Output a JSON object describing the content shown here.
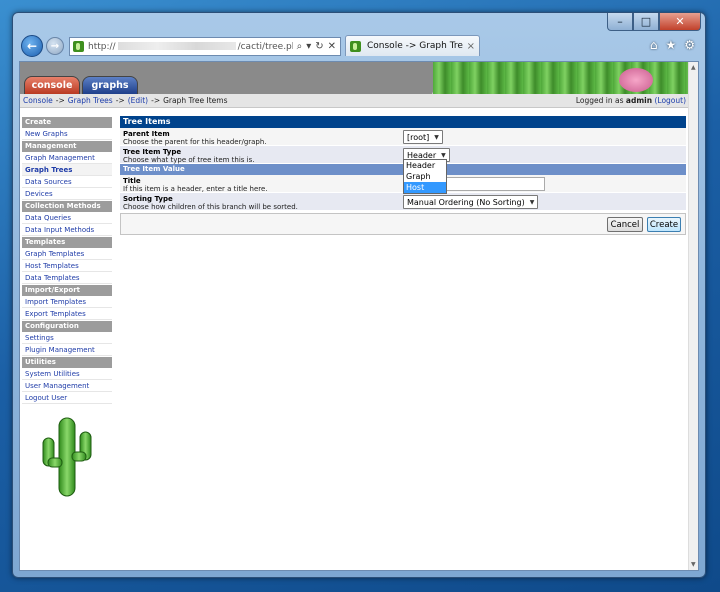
{
  "browser": {
    "url_prefix": "http://",
    "url_suffix": "/cacti/tree.php?actior",
    "tab_title": "Console -> Graph Trees ...",
    "tab_close": "×",
    "back_glyph": "←",
    "forward_glyph": "→",
    "addr_icons": [
      "search-icon",
      "dropdown-icon",
      "refresh-icon",
      "stop-icon"
    ],
    "toolbar_icons": [
      "home-icon",
      "favorites-star-icon",
      "settings-gear-icon"
    ]
  },
  "window": {
    "min": "–",
    "max": "□",
    "close": "✕"
  },
  "header": {
    "console_tab": "console",
    "graphs_tab": "graphs"
  },
  "breadcrumb": {
    "items": [
      "Console",
      "Graph Trees",
      "(Edit)"
    ],
    "separator": "->",
    "current": "Graph Tree Items",
    "login_prefix": "Logged in as",
    "user": "admin",
    "logout": "(Logout)"
  },
  "menu": {
    "create_head": "Create",
    "new_graphs": "New Graphs",
    "management_head": "Management",
    "graph_management": "Graph Management",
    "graph_trees": "Graph Trees",
    "data_sources": "Data Sources",
    "devices": "Devices",
    "collection_head": "Collection Methods",
    "data_queries": "Data Queries",
    "data_input_methods": "Data Input Methods",
    "templates_head": "Templates",
    "graph_templates": "Graph Templates",
    "host_templates": "Host Templates",
    "data_templates": "Data Templates",
    "import_export_head": "Import/Export",
    "import_templates": "Import Templates",
    "export_templates": "Export Templates",
    "configuration_head": "Configuration",
    "settings": "Settings",
    "plugin_management": "Plugin Management",
    "utilities_head": "Utilities",
    "system_utilities": "System Utilities",
    "user_management": "User Management",
    "logout_user": "Logout User"
  },
  "form": {
    "section_title": "Tree Items",
    "parent_label": "Parent Item",
    "parent_desc": "Choose the parent for this header/graph.",
    "parent_value": "[root]",
    "type_label": "Tree Item Type",
    "type_desc": "Choose what type of tree item this is.",
    "type_value": "Header",
    "type_options": [
      "Header",
      "Graph",
      "Host"
    ],
    "type_highlighted": "Host",
    "value_section": "Tree Item Value",
    "title_label": "Title",
    "title_desc": "If this item is a header, enter a title here.",
    "title_value": "",
    "sort_label": "Sorting Type",
    "sort_desc": "Choose how children of this branch will be sorted.",
    "sort_value": "Manual Ordering (No Sorting)",
    "cancel": "Cancel",
    "create": "Create"
  },
  "colors": {
    "section_header": "#00438c",
    "sub_header": "#6d8fc9",
    "menu_header": "#9c9c9c",
    "link": "#1f3ca8",
    "console_tab": "#b93a22",
    "graphs_tab": "#1f3f8a"
  }
}
